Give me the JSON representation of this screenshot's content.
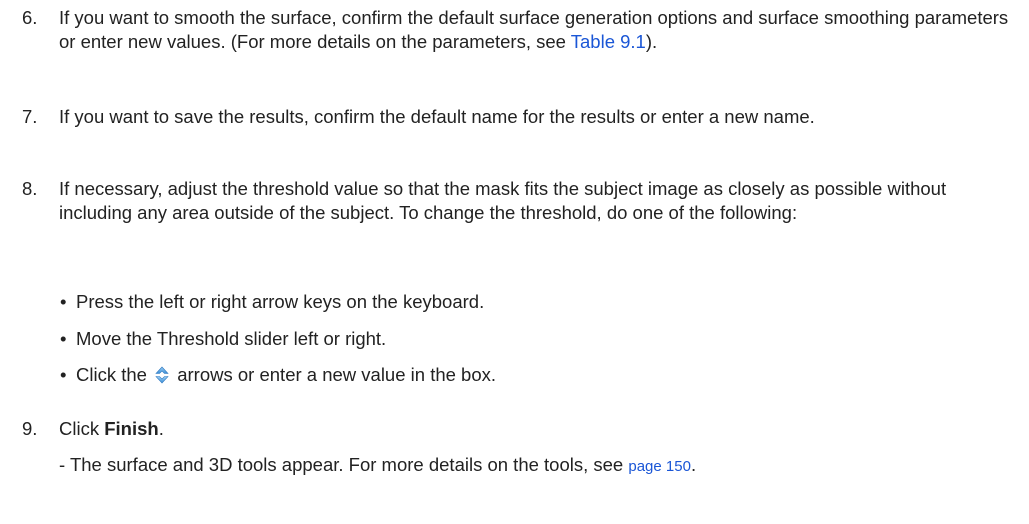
{
  "steps": {
    "s6": {
      "number": "6.",
      "text_before": "If you want to smooth the surface, confirm the default surface generation options and surface smoothing parameters or enter new values. (For more details on the parameters, see ",
      "link": "Table 9.1",
      "text_after": ")."
    },
    "s7": {
      "number": "7.",
      "text": "If you want to save the results, confirm the default name for the results or enter a new name."
    },
    "s8": {
      "number": "8.",
      "text": "If necessary, adjust the threshold value so that the mask fits the subject image as closely as possible without including any area outside of the subject. To change the threshold, do one of the following:",
      "bullets": {
        "b1": "Press the left or right arrow keys on the keyboard.",
        "b2": "Move the Threshold slider left or right.",
        "b3_before": "Click the",
        "b3_after": "arrows or enter a new value in the box."
      }
    },
    "s9": {
      "number": "9.",
      "text_before": "Click ",
      "bold": "Finish",
      "text_after": ".",
      "sub_before": "- The surface and 3D tools appear. For more details on the tools, see ",
      "sub_link": "page 150",
      "sub_after": "."
    }
  },
  "bullet_glyph": "•",
  "colors": {
    "text": "#222222",
    "link": "#1a56d6"
  },
  "icons": {
    "spin_arrows": "up-down-arrows-icon"
  }
}
